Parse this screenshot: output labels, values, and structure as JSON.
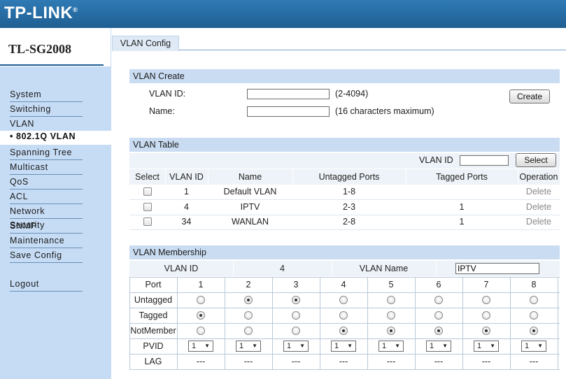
{
  "brand": {
    "name": "TP-LINK",
    "reg": "®"
  },
  "model": "TL-SG2008",
  "nav": [
    "System",
    "Switching",
    "VLAN",
    "Spanning Tree",
    "Multicast",
    "QoS",
    "ACL",
    "Network Security",
    "SNMP",
    "Maintenance",
    "Save Config"
  ],
  "nav_active": "• 802.1Q VLAN",
  "logout": "Logout",
  "tab": "VLAN Config",
  "vlan_create": {
    "title": "VLAN Create",
    "vlan_id_label": "VLAN ID:",
    "vlan_id_hint": "(2-4094)",
    "vlan_id_value": "",
    "name_label": "Name:",
    "name_hint": "(16 characters maximum)",
    "name_value": "",
    "create_button": "Create"
  },
  "vlan_table": {
    "title": "VLAN Table",
    "search_label": "VLAN ID",
    "search_value": "",
    "select_button": "Select",
    "columns": [
      "Select",
      "VLAN ID",
      "Name",
      "Untagged Ports",
      "Tagged Ports",
      "Operation"
    ],
    "rows": [
      {
        "id": "1",
        "name": "Default VLAN",
        "untagged": "1-8",
        "tagged": "",
        "op": "Delete"
      },
      {
        "id": "4",
        "name": "IPTV",
        "untagged": "2-3",
        "tagged": "1",
        "op": "Delete"
      },
      {
        "id": "34",
        "name": "WANLAN",
        "untagged": "2-8",
        "tagged": "1",
        "op": "Delete"
      }
    ]
  },
  "membership": {
    "title": "VLAN Membership",
    "vlan_id_label": "VLAN ID",
    "vlan_id_value": "4",
    "vlan_name_label": "VLAN Name",
    "vlan_name_value": "IPTV",
    "row_labels": [
      "Port",
      "Untagged",
      "Tagged",
      "NotMember",
      "PVID",
      "LAG"
    ],
    "ports": [
      "1",
      "2",
      "3",
      "4",
      "5",
      "6",
      "7",
      "8"
    ],
    "selection": [
      "Tagged",
      "Untagged",
      "Untagged",
      "NotMember",
      "NotMember",
      "NotMember",
      "NotMember",
      "NotMember"
    ],
    "pvid": [
      "1",
      "1",
      "1",
      "1",
      "1",
      "1",
      "1",
      "1"
    ],
    "lag": [
      "---",
      "---",
      "---",
      "---",
      "---",
      "---",
      "---",
      "---"
    ]
  }
}
